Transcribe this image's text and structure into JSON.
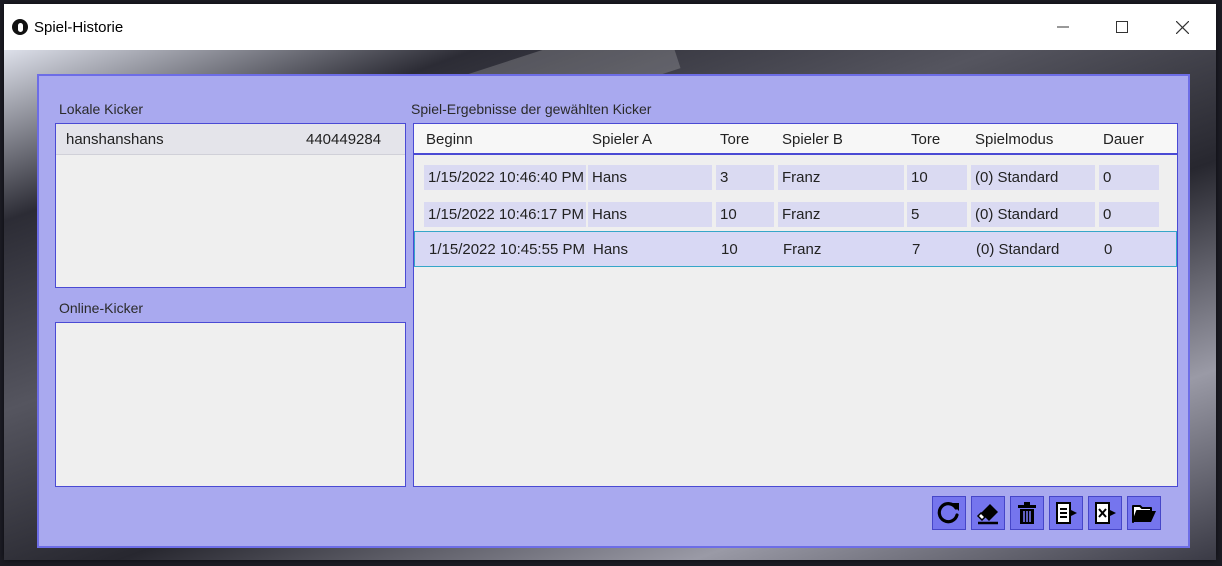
{
  "window": {
    "title": "Spiel-Historie"
  },
  "local": {
    "label": "Lokale Kicker",
    "items": [
      {
        "name": "hanshanshans",
        "id": "440449284"
      }
    ]
  },
  "online": {
    "label": "Online-Kicker"
  },
  "results": {
    "label": "Spiel-Ergebnisse der gewählten Kicker",
    "columns": [
      "Beginn",
      "Spieler A",
      "Tore",
      "Spieler B",
      "Tore",
      "Spielmodus",
      "Dauer"
    ],
    "rows": [
      [
        "1/15/2022 10:46:40 PM",
        "Hans",
        "3",
        "Franz",
        "10",
        "(0) Standard",
        "0"
      ],
      [
        "1/15/2022 10:46:17 PM",
        "Hans",
        "10",
        "Franz",
        "5",
        "(0) Standard",
        "0"
      ],
      [
        "1/15/2022 10:45:55 PM",
        "Hans",
        "10",
        "Franz",
        "7",
        "(0) Standard",
        "0"
      ]
    ],
    "selected_row": 2
  },
  "toolbar": [
    "refresh-icon",
    "eraser-icon",
    "trash-icon",
    "export-list-icon",
    "export-excel-icon",
    "open-folder-icon"
  ],
  "colors": {
    "panel": "#a9a9ef",
    "border": "#4a4ad4",
    "button": "#7575ee"
  }
}
